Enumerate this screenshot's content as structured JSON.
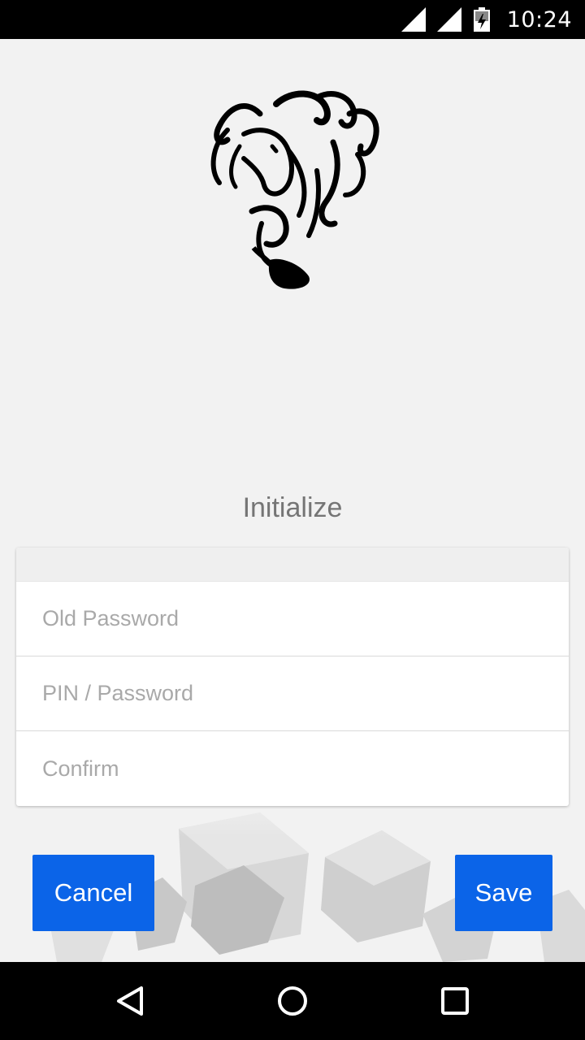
{
  "status_bar": {
    "time": "10:24",
    "icons": [
      "signal-icon",
      "signal-icon",
      "battery-charging-icon"
    ]
  },
  "logo": {
    "icon": "horse-logo-icon"
  },
  "title": "Initialize",
  "form": {
    "old_password": {
      "value": "",
      "placeholder": "Old Password"
    },
    "new_password": {
      "value": "",
      "placeholder": "PIN / Password"
    },
    "confirm": {
      "value": "",
      "placeholder": "Confirm"
    }
  },
  "buttons": {
    "cancel_label": "Cancel",
    "save_label": "Save"
  },
  "nav": {
    "icons": [
      "back-icon",
      "home-icon",
      "recent-apps-icon"
    ]
  },
  "colors": {
    "accent": "#0b64e8",
    "background": "#f2f2f2",
    "title": "#757575",
    "placeholder": "#a9a9a9"
  }
}
